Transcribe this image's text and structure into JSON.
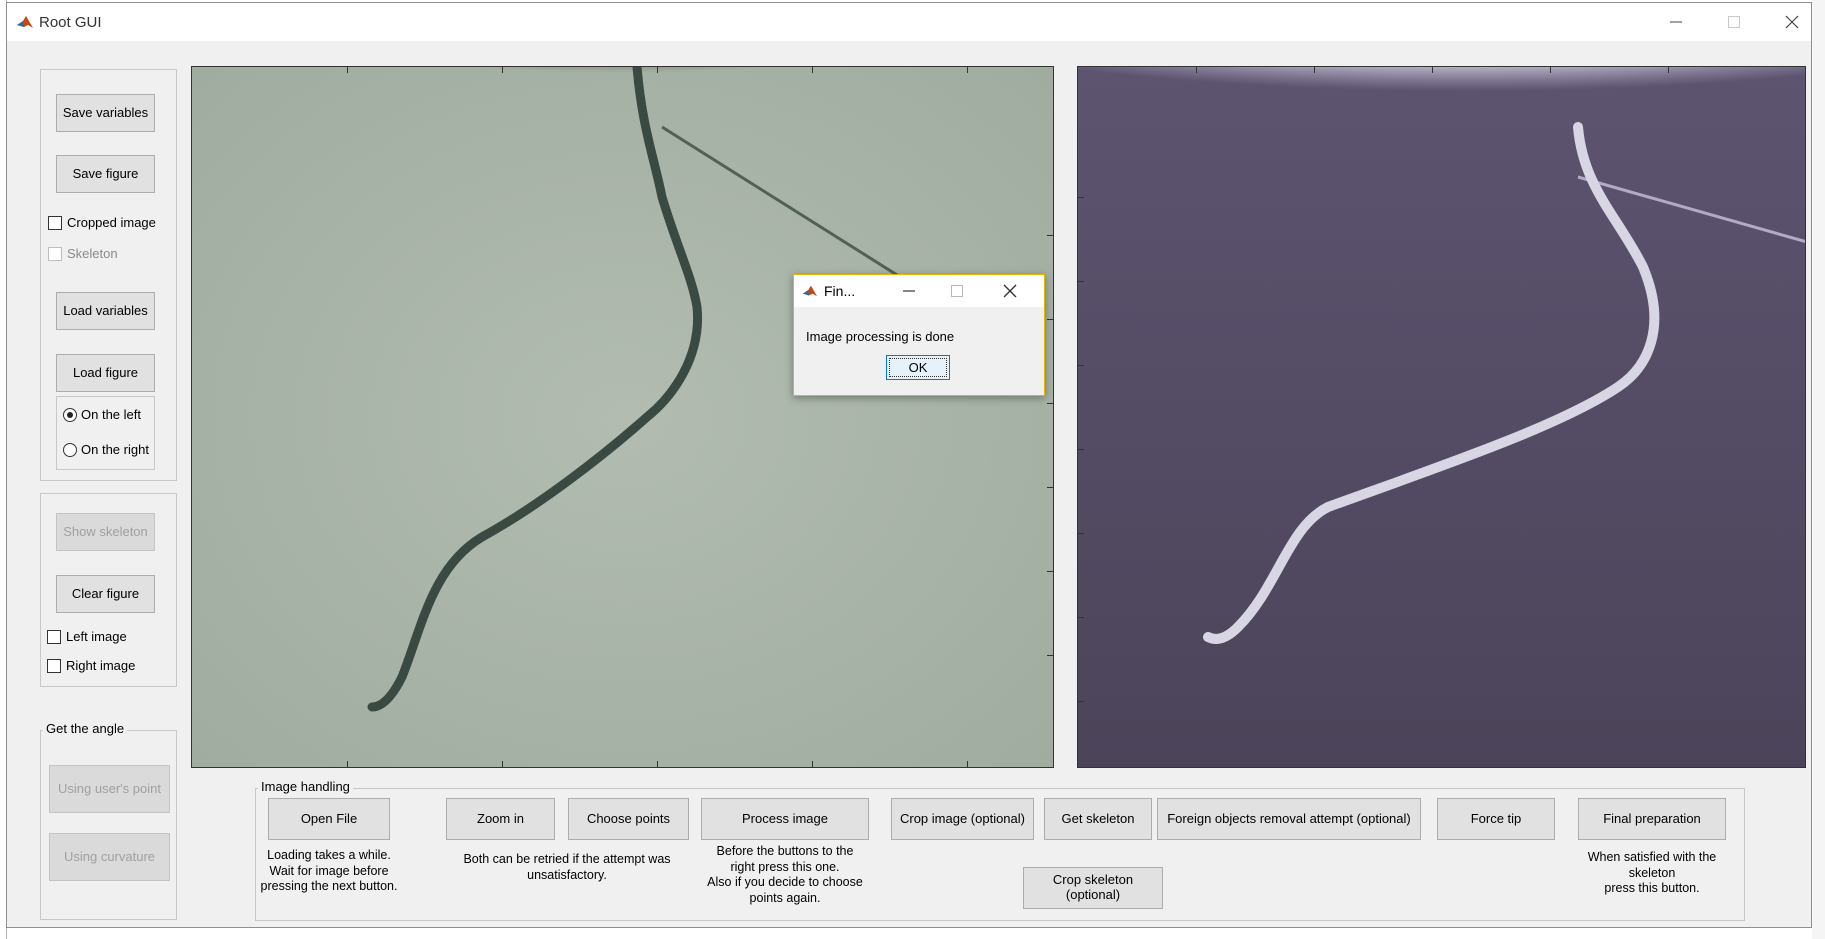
{
  "window": {
    "title": "Root GUI"
  },
  "left_panel": {
    "save_variables": "Save variables",
    "save_figure": "Save figure",
    "cropped_image": "Cropped image",
    "skeleton": "Skeleton",
    "load_variables": "Load variables",
    "load_figure": "Load figure",
    "on_the_left": "On the left",
    "on_the_right": "On the right",
    "show_skeleton": "Show skeleton",
    "clear_figure": "Clear figure",
    "left_image": "Left image",
    "right_image": "Right image"
  },
  "angle_panel": {
    "title": "Get the angle",
    "using_users_point": "Using user's point",
    "using_curvature": "Using curvature"
  },
  "image_handling": {
    "title": "Image handling",
    "open_file": "Open File",
    "open_note": "Loading takes a while.\nWait for  image before\npressing the next button.",
    "zoom_in": "Zoom in",
    "choose_points": "Choose points",
    "retry_note": "Both can be retried if the attempt was\nunsatisfactory.",
    "process_image": "Process image",
    "process_note": "Before the buttons to the\nright press this one.\nAlso if you decide to choose\npoints again.",
    "crop_image": "Crop image (optional)",
    "get_skeleton": "Get skeleton",
    "foreign_objects": "Foreign objects removal attempt (optional)",
    "force_tip": "Force tip",
    "final_preparation": "Final preparation",
    "final_note": "When satisfied with the\nskeleton\npress this button.",
    "crop_skeleton": "Crop skeleton (optional)"
  },
  "dialog": {
    "title": "Fin...",
    "message": "Image processing is done",
    "ok": "OK"
  },
  "colors": {
    "accent": "#0078d7",
    "dialog_border": "#e8b400",
    "left_image_bg": "#a9b5a8",
    "right_image_bg": "#4f4660"
  },
  "icons": {
    "app": "matlab-icon",
    "minimize": "minimize-icon",
    "maximize": "maximize-icon",
    "close": "close-icon"
  }
}
